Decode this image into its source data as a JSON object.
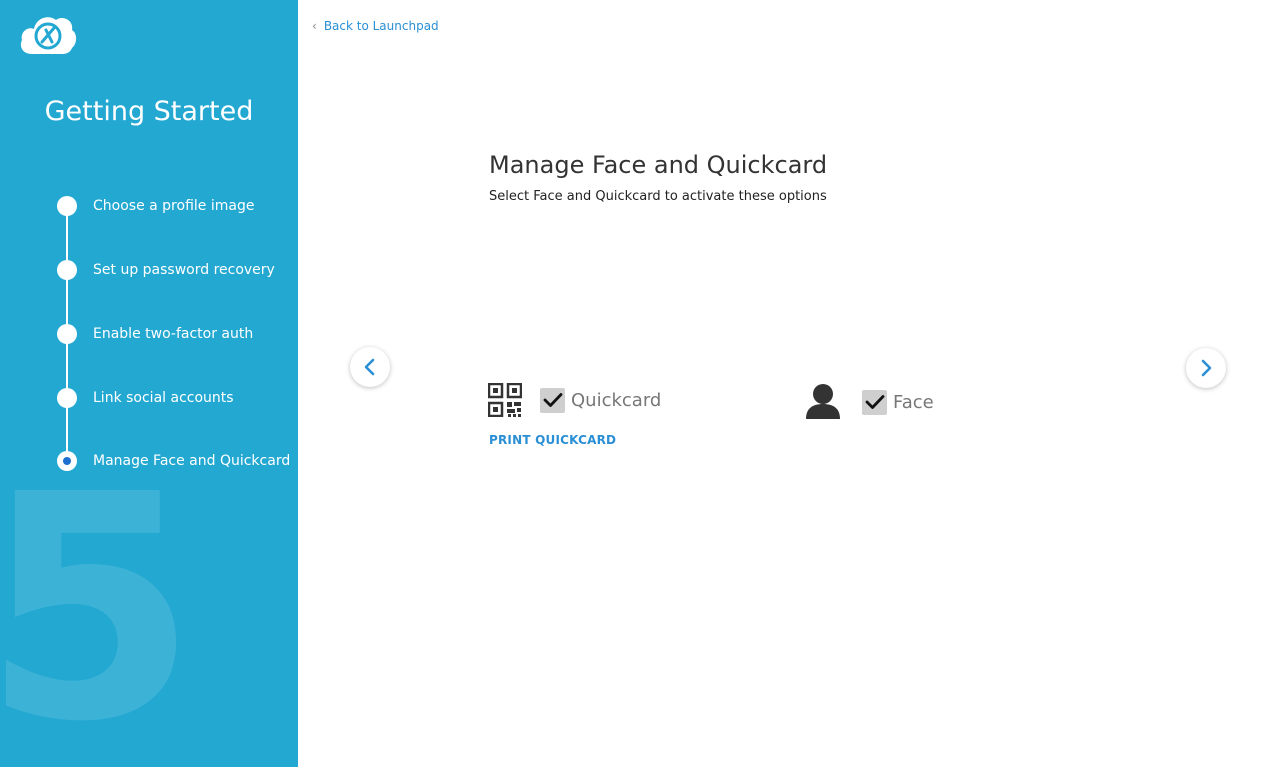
{
  "sidebar": {
    "title": "Getting Started",
    "current_step_number": "5",
    "steps": [
      {
        "label": "Choose a profile image",
        "active": false
      },
      {
        "label": "Set up password recovery",
        "active": false
      },
      {
        "label": "Enable two-factor auth",
        "active": false
      },
      {
        "label": "Link social accounts",
        "active": false
      },
      {
        "label": "Manage Face and Quickcard",
        "active": true
      }
    ]
  },
  "header": {
    "back_label": "Back to Launchpad"
  },
  "main": {
    "title": "Manage Face and Quickcard",
    "subtitle": "Select Face and Quickcard to activate these options",
    "options": {
      "quickcard": {
        "label": "Quickcard",
        "checked": true,
        "icon": "qr-code-icon"
      },
      "face": {
        "label": "Face",
        "checked": true,
        "icon": "user-silhouette-icon"
      }
    },
    "print_label": "PRINT QUICKCARD"
  },
  "colors": {
    "sidebar_bg": "#23a8d2",
    "accent": "#2a8fd4",
    "active_dot": "#1f6fd1"
  }
}
